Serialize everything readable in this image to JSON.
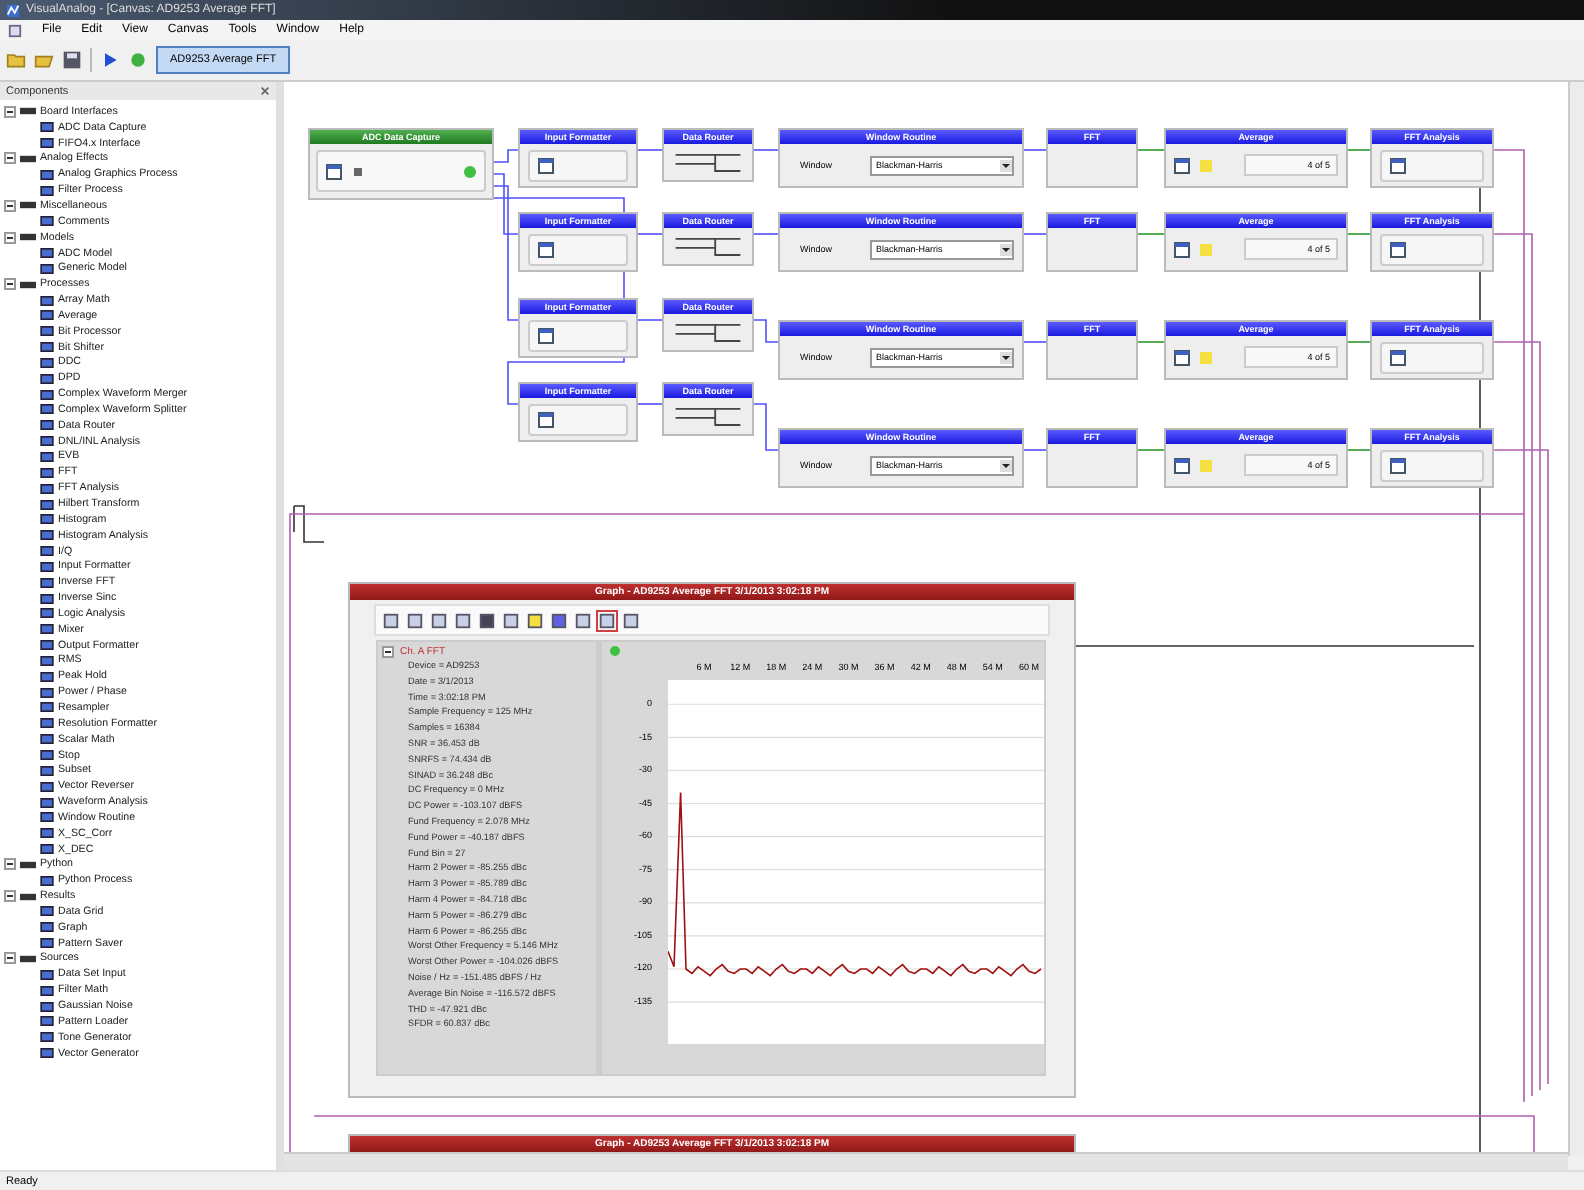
{
  "window": {
    "title": "VisualAnalog - [Canvas: AD9253 Average FFT]"
  },
  "menu": [
    "File",
    "Edit",
    "View",
    "Canvas",
    "Tools",
    "Window",
    "Help"
  ],
  "toolbar": {
    "canvas_tab": {
      "label": "AD9253 Average FFT",
      "selected": true
    }
  },
  "components": {
    "title": "Components",
    "categories": [
      {
        "label": "Board Interfaces",
        "expanded": true,
        "children": [
          "ADC Data Capture",
          "FIFO4.x Interface"
        ]
      },
      {
        "label": "Analog Effects",
        "expanded": true,
        "children": [
          "Analog Graphics Process",
          "Filter Process"
        ]
      },
      {
        "label": "Miscellaneous",
        "expanded": true,
        "children": [
          "Comments"
        ]
      },
      {
        "label": "Models",
        "expanded": true,
        "children": [
          "ADC Model",
          "Generic Model"
        ]
      },
      {
        "label": "Processes",
        "expanded": true,
        "children": [
          "Array Math",
          "Average",
          "Bit Processor",
          "Bit Shifter",
          "DDC",
          "DPD",
          "Complex Waveform Merger",
          "Complex Waveform Splitter",
          "Data Router",
          "DNL/INL Analysis",
          "EVB",
          "FFT",
          "FFT Analysis",
          "Hilbert Transform",
          "Histogram",
          "Histogram Analysis",
          "I/Q",
          "Input Formatter",
          "Inverse FFT",
          "Inverse Sinc",
          "Logic Analysis",
          "Mixer",
          "Output Formatter",
          "RMS",
          "Peak Hold",
          "Power / Phase",
          "Resampler",
          "Resolution Formatter",
          "Scalar Math",
          "Stop",
          "Subset",
          "Vector Reverser",
          "Waveform Analysis",
          "Window Routine",
          "X_SC_Corr",
          "X_DEC"
        ]
      },
      {
        "label": "Python",
        "expanded": true,
        "children": [
          "Python Process"
        ]
      },
      {
        "label": "Results",
        "expanded": true,
        "children": [
          "Data Grid",
          "Graph",
          "Pattern Saver"
        ]
      },
      {
        "label": "Sources",
        "expanded": true,
        "children": [
          "Data Set Input",
          "Filter Math",
          "Gaussian Noise",
          "Pattern Loader",
          "Tone Generator",
          "Vector Generator"
        ]
      }
    ]
  },
  "canvas": {
    "capture": {
      "title": "ADC Data Capture",
      "status_on": true
    },
    "chains": [
      {
        "formatter": "Input Formatter",
        "router": "Data Router",
        "window": {
          "title": "Window Routine",
          "label": "Window",
          "value": "Blackman-Harris"
        },
        "fft": "FFT",
        "average": {
          "title": "Average",
          "progress": "4 of 5"
        },
        "analysis": "FFT Analysis"
      },
      {
        "formatter": "Input Formatter",
        "router": "Data Router",
        "window": {
          "title": "Window Routine",
          "label": "Window",
          "value": "Blackman-Harris"
        },
        "fft": "FFT",
        "average": {
          "title": "Average",
          "progress": "4 of 5"
        },
        "analysis": "FFT Analysis"
      },
      {
        "formatter": "Input Formatter",
        "router": "Data Router",
        "window": {
          "title": "Window Routine",
          "label": "Window",
          "value": "Blackman-Harris"
        },
        "fft": "FFT",
        "average": {
          "title": "Average",
          "progress": "4 of 5"
        },
        "analysis": "FFT Analysis"
      },
      {
        "formatter": "Input Formatter",
        "router": "Data Router",
        "window": {
          "title": "Window Routine",
          "label": "Window",
          "value": "Blackman-Harris"
        },
        "fft": "FFT",
        "average": {
          "title": "Average",
          "progress": "4 of 5"
        },
        "analysis": "FFT Analysis"
      }
    ],
    "graph": {
      "title": "Graph - AD9253 Average FFT 3/1/2013 3:02:18 PM",
      "status_on": true,
      "tree": {
        "label": "Ch. A FFT",
        "expanded": true,
        "children": [
          "Device = AD9253",
          "Date = 3/1/2013",
          "Time = 3:02:18 PM",
          "Sample Frequency = 125 MHz",
          "Samples = 16384",
          "SNR = 36.453 dB",
          "SNRFS = 74.434 dB",
          "SINAD = 36.248 dBc",
          "DC Frequency = 0 MHz",
          "DC Power = -103.107 dBFS",
          "Fund Frequency = 2.078 MHz",
          "Fund Power = -40.187 dBFS",
          "Fund Bin = 27",
          "Harm 2 Power = -85.255 dBc",
          "Harm 3 Power = -85.789 dBc",
          "Harm 4 Power = -84.718 dBc",
          "Harm 5 Power = -86.279 dBc",
          "Harm 6 Power = -86.255 dBc",
          "Worst Other Frequency = 5.146 MHz",
          "Worst Other Power = -104.026 dBFS",
          "Noise / Hz = -151.485 dBFS / Hz",
          "Average Bin Noise = -116.572 dBFS",
          "THD = -47.921 dBc",
          "SFDR = 60.837 dBc"
        ]
      },
      "chart_data": {
        "type": "line",
        "grid": true,
        "xlim": [
          0,
          62.5
        ],
        "ylim": [
          -154,
          11
        ],
        "xticks": [
          {
            "value": 6,
            "label": "6 M"
          },
          {
            "value": 12,
            "label": "12 M"
          },
          {
            "value": 18,
            "label": "18 M"
          },
          {
            "value": 24,
            "label": "24 M"
          },
          {
            "value": 30,
            "label": "30 M"
          },
          {
            "value": 36,
            "label": "36 M"
          },
          {
            "value": 42,
            "label": "42 M"
          },
          {
            "value": 48,
            "label": "48 M"
          },
          {
            "value": 54,
            "label": "54 M"
          },
          {
            "value": 60,
            "label": "60 M"
          }
        ],
        "yticks": [
          0,
          -15,
          -30,
          -45,
          -60,
          -75,
          -90,
          -105,
          -120,
          -135
        ],
        "x": [
          0,
          1,
          2.078,
          3,
          4,
          5,
          6,
          7,
          8,
          9,
          10,
          11,
          12,
          13,
          14,
          15,
          16,
          17,
          18,
          19,
          20,
          21,
          22,
          23,
          24,
          25,
          26,
          27,
          28,
          29,
          30,
          31,
          32,
          33,
          34,
          35,
          36,
          37,
          38,
          39,
          40,
          41,
          42,
          43,
          44,
          45,
          46,
          47,
          48,
          49,
          50,
          51,
          52,
          53,
          54,
          55,
          56,
          57,
          58,
          59,
          60,
          61,
          62
        ],
        "series": [
          {
            "color": "#a01010",
            "values": [
              -112,
              -119,
              -40,
              -120,
              -122,
              -119,
              -121,
              -123,
              -120,
              -118,
              -121,
              -122,
              -120,
              -120,
              -122,
              -119,
              -121,
              -123,
              -120,
              -118,
              -121,
              -122,
              -120,
              -120,
              -122,
              -119,
              -121,
              -123,
              -120,
              -118,
              -121,
              -122,
              -120,
              -120,
              -122,
              -119,
              -121,
              -123,
              -120,
              -118,
              -121,
              -122,
              -120,
              -120,
              -122,
              -119,
              -121,
              -123,
              -120,
              -118,
              -121,
              -122,
              -120,
              -120,
              -122,
              -119,
              -121,
              -123,
              -120,
              -118,
              -121,
              -122,
              -120
            ]
          }
        ]
      }
    },
    "second_graph": {
      "title": "Graph - AD9253 Average FFT 3/1/2013 3:02:18 PM"
    }
  },
  "status_bar": {
    "text": "Ready"
  }
}
